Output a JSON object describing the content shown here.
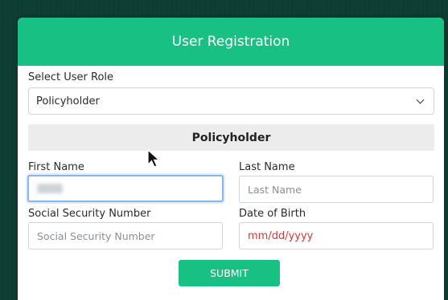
{
  "form": {
    "title": "User Registration",
    "role_label": "Select User Role",
    "role_value": "Policyholder",
    "section_title": "Policyholder",
    "first_name_label": "First Name",
    "last_name_label": "Last Name",
    "last_name_placeholder": "Last Name",
    "ssn_label": "Social Security Number",
    "ssn_placeholder": "Social Security Number",
    "dob_label": "Date of Birth",
    "dob_placeholder": "mm/dd/yyyy",
    "submit_label": "SUBMIT"
  },
  "icons": {
    "select_arrow": "chevron-down-icon",
    "cursor": "mouse-pointer-icon"
  },
  "colors": {
    "accent": "#19c084",
    "date_text": "#e03535",
    "focus_border": "#86b6ec",
    "section_bg": "#ececec"
  }
}
